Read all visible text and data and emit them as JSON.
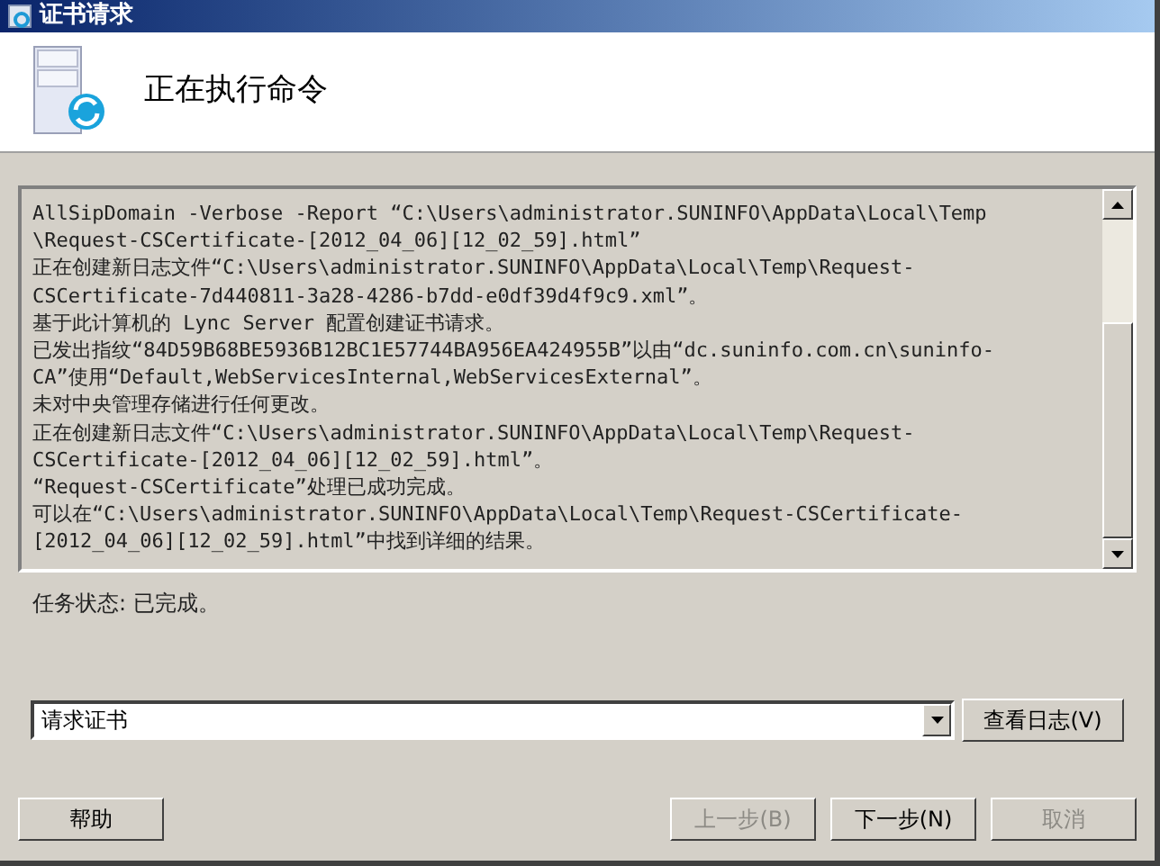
{
  "window": {
    "title": "证书请求"
  },
  "header": {
    "title": "正在执行命令"
  },
  "log": {
    "lines": [
      "AllSipDomain -Verbose -Report “C:\\Users\\administrator.SUNINFO\\AppData\\Local\\Temp",
      "\\Request-CSCertificate-[2012_04_06][12_02_59].html”",
      "正在创建新日志文件“C:\\Users\\administrator.SUNINFO\\AppData\\Local\\Temp\\Request-",
      "CSCertificate-7d440811-3a28-4286-b7dd-e0df39d4f9c9.xml”。",
      "基于此计算机的 Lync Server 配置创建证书请求。",
      "已发出指纹“84D59B68BE5936B12BC1E57744BA956EA424955B”以由“dc.suninfo.com.cn\\suninfo-",
      "CA”使用“Default,WebServicesInternal,WebServicesExternal”。",
      "未对中央管理存储进行任何更改。",
      "正在创建新日志文件“C:\\Users\\administrator.SUNINFO\\AppData\\Local\\Temp\\Request-",
      "CSCertificate-[2012_04_06][12_02_59].html”。",
      "“Request-CSCertificate”处理已成功完成。",
      "可以在“C:\\Users\\administrator.SUNINFO\\AppData\\Local\\Temp\\Request-CSCertificate-",
      "[2012_04_06][12_02_59].html”中找到详细的结果。"
    ]
  },
  "status": {
    "label": "任务状态:",
    "value": "已完成。"
  },
  "task_select": {
    "value": "请求证书"
  },
  "view_log_button": {
    "label": "查看日志(V)",
    "disabled": false
  },
  "buttons": [
    {
      "label": "帮助",
      "disabled": false
    },
    {
      "label": "上一步(B)",
      "disabled": true
    },
    {
      "label": "下一步(N)",
      "disabled": false
    },
    {
      "label": "取消",
      "disabled": true
    }
  ]
}
